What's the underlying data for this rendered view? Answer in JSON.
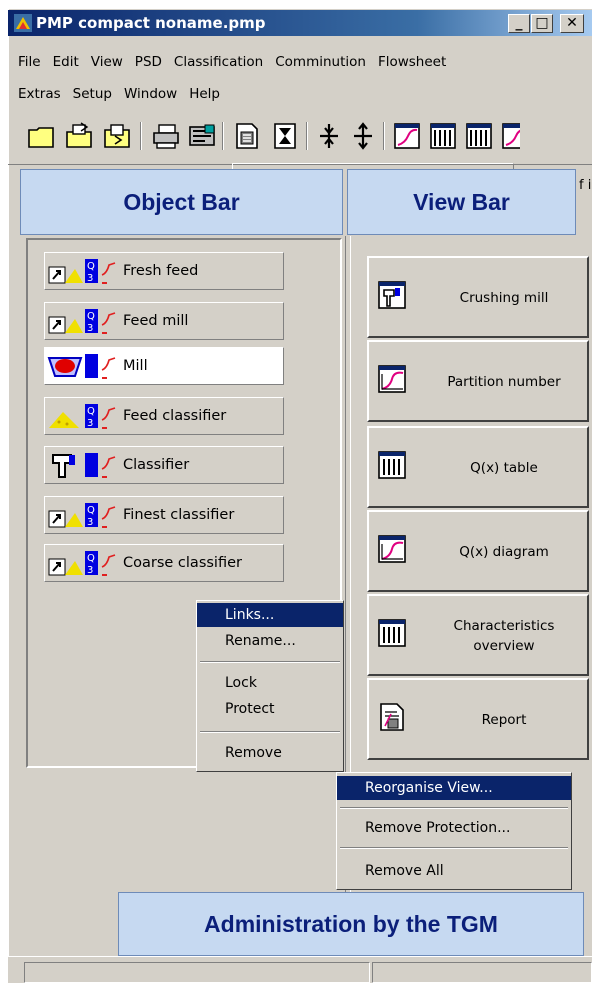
{
  "window": {
    "title": "PMP compact  noname.pmp"
  },
  "title_buttons": {
    "minimize": "_",
    "maximize": "□",
    "close": "✕"
  },
  "menu_row1": [
    "File",
    "Edit",
    "View",
    "PSD",
    "Classification",
    "Comminution",
    "Flowsheet"
  ],
  "menu_row2": [
    "Extras",
    "Setup",
    "Window",
    "Help"
  ],
  "toolbar_icons": [
    "new-file-icon",
    "open-file-icon",
    "save-file-icon",
    "print-icon",
    "setup-tools-icon",
    "calculator-icon",
    "hourglass-icon",
    "compress-icon",
    "expand-icon",
    "diagram-icon",
    "table-icon",
    "table-icon",
    "diagram-icon"
  ],
  "headers": {
    "object_bar": "Object Bar",
    "view_bar": "View Bar",
    "admin": "Administration by the TGM"
  },
  "objects": [
    {
      "label": "Fresh feed",
      "icon": "feed-q3-icon"
    },
    {
      "label": "Feed mill",
      "icon": "feed-q3-icon"
    },
    {
      "label": "Mill",
      "icon": "mill-icon"
    },
    {
      "label": "Feed classifier",
      "icon": "heap-q3-icon"
    },
    {
      "label": "Classifier",
      "icon": "classifier-icon"
    },
    {
      "label": "Finest classifier",
      "icon": "feed-q3-icon"
    },
    {
      "label": "Coarse classifier",
      "icon": "feed-q3-icon"
    }
  ],
  "views": [
    {
      "line1": "Crushing mill",
      "line2": "",
      "icon": "crushing-mill-icon"
    },
    {
      "line1": "Partition number",
      "line2": "",
      "icon": "diagram-icon"
    },
    {
      "line1": "Q(x) table",
      "line2": "",
      "icon": "table-icon"
    },
    {
      "line1": "Q(x) diagram",
      "line2": "",
      "icon": "diagram-icon"
    },
    {
      "line1": "Characteristics",
      "line2": "overview",
      "icon": "table-icon"
    },
    {
      "line1": "Report",
      "line2": "",
      "icon": "report-icon"
    }
  ],
  "object_context_menu": {
    "links": "Links...",
    "rename": "Rename...",
    "lock": "Lock",
    "protect": "Protect",
    "remove": "Remove"
  },
  "view_context_menu": {
    "reorganise": "Reorganise View...",
    "remove_protection": "Remove Protection...",
    "remove_all": "Remove All"
  },
  "colors": {
    "title_blue": "#0a246a",
    "header_fill": "#c6d9f1",
    "header_text": "#0b1f7a",
    "highlight": "#0a246a"
  }
}
